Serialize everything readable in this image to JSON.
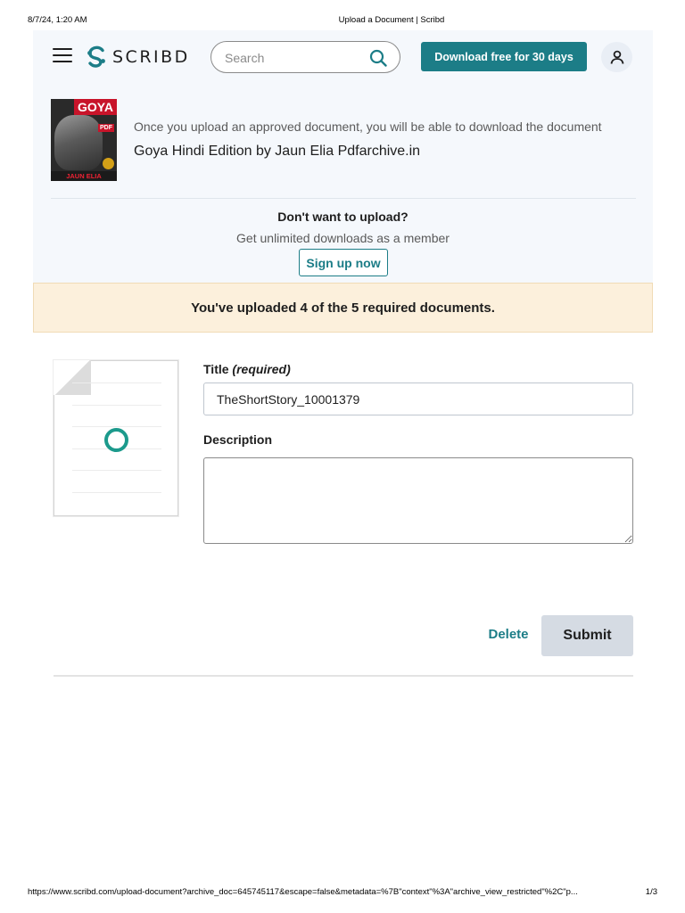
{
  "print": {
    "date": "8/7/24, 1:20 AM",
    "title": "Upload a Document | Scribd",
    "url": "https://www.scribd.com/upload-document?archive_doc=645745117&escape=false&metadata=%7B\"context\"%3A\"archive_view_restricted\"%2C\"p...",
    "page": "1/3"
  },
  "header": {
    "logo_text": "SCRIBD",
    "search_placeholder": "Search",
    "download_label": "Download free for 30 days",
    "menu_icon": "hamburger-menu-icon",
    "search_icon": "magnifier-icon",
    "user_icon": "person-icon"
  },
  "document": {
    "upload_note": "Once you upload an approved document, you will be able to download the document",
    "title": "Goya Hindi Edition by Jaun Elia Pdfarchive.in",
    "cover": {
      "title_text": "GOYA",
      "pdf_tag": "PDF",
      "author_text": "JAUN ELIA"
    }
  },
  "membership": {
    "heading": "Don't want to upload?",
    "subtext": "Get unlimited downloads as a member",
    "signup_label": "Sign up now"
  },
  "notice": {
    "text": "You've uploaded 4 of the 5 required documents."
  },
  "form": {
    "title_label": "Title",
    "title_required": "(required)",
    "title_value": "TheShortStory_10001379",
    "description_label": "Description",
    "description_value": "",
    "delete_label": "Delete",
    "submit_label": "Submit"
  },
  "colors": {
    "brand_teal": "#1c7d87",
    "notice_bg": "#fcf0dc",
    "panel_bg": "#f5f8fc",
    "submit_disabled": "#d5dbe3"
  }
}
